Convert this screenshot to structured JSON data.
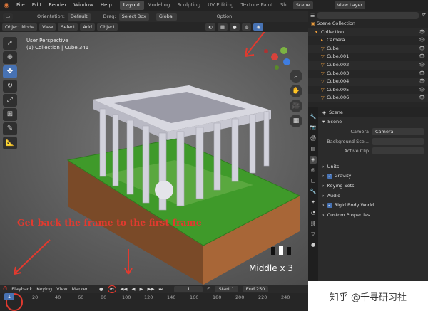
{
  "menu": {
    "items": [
      "File",
      "Edit",
      "Render",
      "Window",
      "Help"
    ],
    "workspaces": [
      "Layout",
      "Modeling",
      "Sculpting",
      "UV Editing",
      "Texture Paint",
      "Sh"
    ],
    "active_workspace": "Layout",
    "scene": "Scene",
    "view_layer": "View Layer"
  },
  "toolrow": {
    "orientation_label": "Orientation:",
    "orientation_value": "Default",
    "drag_label": "Drag:",
    "drag_value": "Select Box",
    "transform_value": "Global",
    "options_label": "Option"
  },
  "vphead": {
    "mode": "Object Mode",
    "view": "View",
    "select": "Select",
    "add": "Add",
    "object": "Object"
  },
  "overlay": {
    "line1": "User Perspective",
    "line2": "(1) Collection | Cube.341"
  },
  "annotation": "Get back the frame to the first frame",
  "middle_label": "Middle x 3",
  "timehead": {
    "playback": "Playback",
    "keying": "Keying",
    "view": "View",
    "marker": "Marker",
    "frame": "1",
    "start_label": "Start",
    "start_val": "1",
    "end_label": "End",
    "end_val": "250"
  },
  "timeline": {
    "current": "1",
    "ticks": [
      "20",
      "40",
      "60",
      "80",
      "100",
      "120",
      "140",
      "160",
      "180",
      "200",
      "220",
      "240"
    ]
  },
  "outliner": {
    "title": "Scene Collection",
    "rows": [
      {
        "name": "Collection"
      },
      {
        "name": "Camera"
      },
      {
        "name": "Cube"
      },
      {
        "name": "Cube.001"
      },
      {
        "name": "Cube.002"
      },
      {
        "name": "Cube.003"
      },
      {
        "name": "Cube.004"
      },
      {
        "name": "Cube.005"
      },
      {
        "name": "Cube.006"
      }
    ]
  },
  "props": {
    "header": "Scene",
    "section": "Scene",
    "camera_label": "Camera",
    "camera_val": "Camera",
    "bg_label": "Background Sce...",
    "clip_label": "Active Clip",
    "units": "Units",
    "gravity": "Gravity",
    "keying_sets": "Keying Sets",
    "audio": "Audio",
    "rbw": "Rigid Body World",
    "custom": "Custom Properties"
  },
  "watermark": "知乎 @千寻研习社",
  "colors": {
    "accent": "#4772b3",
    "annotation": "#e23a2f",
    "orange": "#e99b3c"
  }
}
